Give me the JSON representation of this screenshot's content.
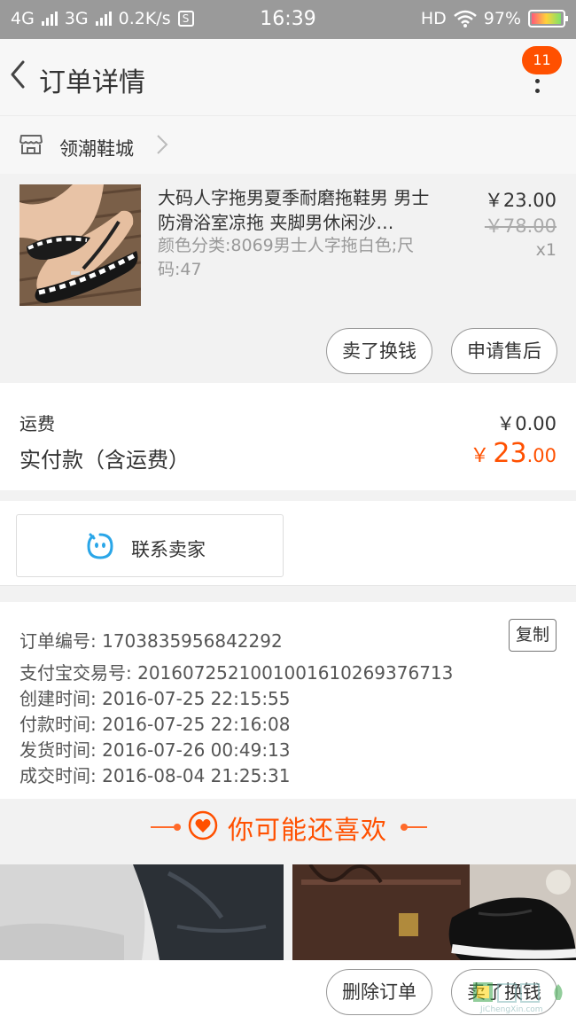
{
  "status_bar": {
    "net1": "4G",
    "net2": "3G",
    "speed": "0.2K/s",
    "speed_icon": "S",
    "time": "16:39",
    "hd": "HD",
    "battery": "97%"
  },
  "header": {
    "title": "订单详情",
    "badge": "11"
  },
  "shop": {
    "name": "领潮鞋城"
  },
  "item": {
    "title": "大码人字拖男夏季耐磨拖鞋男 男士防滑浴室凉拖 夹脚男休闲沙…",
    "sku": "颜色分类:8069男士人字拖白色;尺码:47",
    "price": "￥23.00",
    "original_price": "￥78.00",
    "quantity": "x1",
    "buttons": {
      "resell": "卖了换钱",
      "after_sale": "申请售后"
    }
  },
  "fees": {
    "shipping_label": "运费",
    "shipping_value": "￥0.00",
    "paid_label": "实付款（含运费）",
    "paid_currency": "￥",
    "paid_int": "23",
    "paid_dec": ".00"
  },
  "contact": {
    "label": "联系卖家"
  },
  "order": {
    "number": "订单编号: 1703835956842292",
    "alipay": "支付宝交易号: 2016072521001001610269376713",
    "created": "创建时间: 2016-07-25 22:15:55",
    "paid": "付款时间: 2016-07-25 22:16:08",
    "shipped": "发货时间: 2016-07-26 00:49:13",
    "completed": "成交时间: 2016-08-04 21:25:31",
    "copy_label": "复制"
  },
  "recommend": {
    "title": "你可能还喜欢"
  },
  "bottom": {
    "delete_order": "删除订单",
    "resell": "卖了换钱"
  },
  "watermark": {
    "text": "JiChengXin.com"
  },
  "colors": {
    "accent": "#ff5000",
    "status_bar": "#9a9a9a",
    "contact_icon": "#2aa6e8"
  }
}
